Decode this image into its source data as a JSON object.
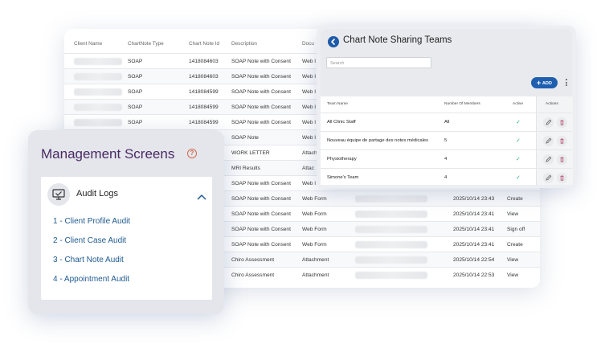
{
  "audit_table": {
    "headers": [
      "Client Name",
      "ChartNote Type",
      "Chart Note Id",
      "Description",
      "Docu"
    ],
    "rows": [
      {
        "type": "SOAP",
        "id": "1418084603",
        "desc": "SOAP Note with Consent",
        "doc": "Web I",
        "date": "",
        "action": ""
      },
      {
        "type": "SOAP",
        "id": "1418084603",
        "desc": "SOAP Note with Consent",
        "doc": "Web I",
        "date": "",
        "action": ""
      },
      {
        "type": "SOAP",
        "id": "1418084599",
        "desc": "SOAP Note with Consent",
        "doc": "Web I",
        "date": "",
        "action": ""
      },
      {
        "type": "SOAP",
        "id": "1418084599",
        "desc": "SOAP Note with Consent",
        "doc": "Web I",
        "date": "",
        "action": ""
      },
      {
        "type": "SOAP",
        "id": "1418084599",
        "desc": "SOAP Note with Consent",
        "doc": "Web I",
        "date": "",
        "action": ""
      },
      {
        "type": "",
        "id": "",
        "desc": "SOAP Note",
        "doc": "Web I",
        "date": "",
        "action": ""
      },
      {
        "type": "",
        "id": "",
        "desc": "WORK LETTER",
        "doc": "Attach",
        "date": "",
        "action": ""
      },
      {
        "type": "",
        "id": "",
        "desc": "MRI Results",
        "doc": "Attac",
        "date": "",
        "action": ""
      },
      {
        "type": "",
        "id": "",
        "desc": "SOAP Note with Consent",
        "doc": "Web I",
        "date": "",
        "action": ""
      },
      {
        "type": "",
        "id": "",
        "desc": "SOAP Note with Consent",
        "doc": "Web Form",
        "date": "2025/10/14 23:43",
        "action": "Create"
      },
      {
        "type": "",
        "id": "",
        "desc": "SOAP Note with Consent",
        "doc": "Web Form",
        "date": "2025/10/14 23:41",
        "action": "View"
      },
      {
        "type": "",
        "id": "",
        "desc": "SOAP Note with Consent",
        "doc": "Web Form",
        "date": "2025/10/14 23:41",
        "action": "Sign off"
      },
      {
        "type": "",
        "id": "",
        "desc": "SOAP Note with Consent",
        "doc": "Web Form",
        "date": "2025/10/14 23:41",
        "action": "Create"
      },
      {
        "type": "",
        "id": "",
        "desc": "Chiro Assessment",
        "doc": "Attachment",
        "date": "2025/10/14 22:54",
        "action": "View"
      },
      {
        "type": "",
        "id": "",
        "desc": "Chiro Assessment",
        "doc": "Attachment",
        "date": "2025/10/14 22:53",
        "action": "View"
      }
    ]
  },
  "teams_panel": {
    "title": "Chart Note Sharing Teams",
    "search_placeholder": "Search",
    "add_label": "ADD",
    "headers": {
      "name": "Team Name",
      "members": "Number Of Members",
      "active": "Active",
      "actions": "Actions"
    },
    "rows": [
      {
        "name": "All Clinic Staff",
        "members": "All",
        "active": "✓"
      },
      {
        "name": "Nouveau équipe de partage des notes médicales",
        "members": "5",
        "active": "✓"
      },
      {
        "name": "Physiotherapy",
        "members": "4",
        "active": "✓"
      },
      {
        "name": "Simone's Team",
        "members": "4",
        "active": "✓"
      }
    ],
    "colors": {
      "accent": "#1f5fb0",
      "check": "#2ab07a"
    }
  },
  "management": {
    "title": "Management Screens",
    "help_glyph": "?",
    "section_label": "Audit Logs",
    "links": [
      "1 - Client Profile Audit",
      "2 - Client Case Audit",
      "3 - Chart Note Audit",
      "4 - Appointment Audit"
    ],
    "colors": {
      "title": "#4a2a63",
      "link": "#1f5a8f"
    }
  }
}
